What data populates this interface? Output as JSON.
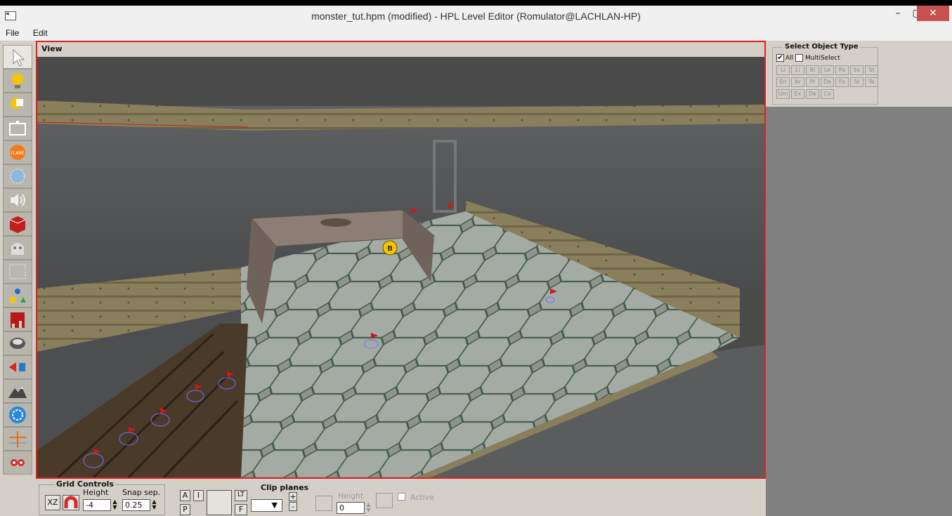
{
  "window": {
    "title": "monster_tut.hpm (modified) - HPL Level Editor  (Romulator@LACHLAN-HP)",
    "minimize": "–",
    "maximize": "▢",
    "close": "✕"
  },
  "menu": [
    "File",
    "Edit"
  ],
  "view": {
    "label": "View"
  },
  "select_object_type": {
    "title": "Select Object Type",
    "all_label": "All",
    "all_checked": true,
    "multiselect_label": "MultiSelect",
    "multiselect_checked": false,
    "types": [
      "Li",
      "Li",
      "Bi",
      "Le",
      "Pa",
      "So",
      "St",
      "En",
      "Ar",
      "Pr",
      "De",
      "Fo",
      "St",
      "Te",
      "Um",
      "Ex",
      "De",
      "Co"
    ]
  },
  "grid_controls": {
    "title": "Grid Controls",
    "plane_label": "XZ",
    "height_label": "Height",
    "height_value": "-4",
    "snap_label": "Snap sep.",
    "snap_value": "0.25"
  },
  "view_buttons": {
    "a": "A",
    "i": "I",
    "p": "P",
    "lt": "LT",
    "f": "F"
  },
  "clip_planes": {
    "title": "Clip planes",
    "plus": "+",
    "minus": "-",
    "height_label": "Height",
    "height_value": "0",
    "active_label": "Active"
  },
  "toolbox": [
    "select-tool-icon",
    "light-tool-icon",
    "spotlight-tool-icon",
    "billboard-tool-icon",
    "flare-tool-icon",
    "particle-tool-icon",
    "sound-tool-icon",
    "entity-tool-icon",
    "area-tool-icon",
    "primitive-tool-icon",
    "shapes-tool-icon",
    "decal-tool-icon",
    "fog-tool-icon",
    "combine-tool-icon",
    "terrain-tool-icon",
    "fan-tool-icon",
    "grid-tool-icon",
    "misc-tool-icon"
  ],
  "scene": {
    "marker_letter": "B"
  },
  "colors": {
    "viewport_border": "#e02020",
    "panel": "#d4d0c8",
    "close_button": "#c75050"
  }
}
